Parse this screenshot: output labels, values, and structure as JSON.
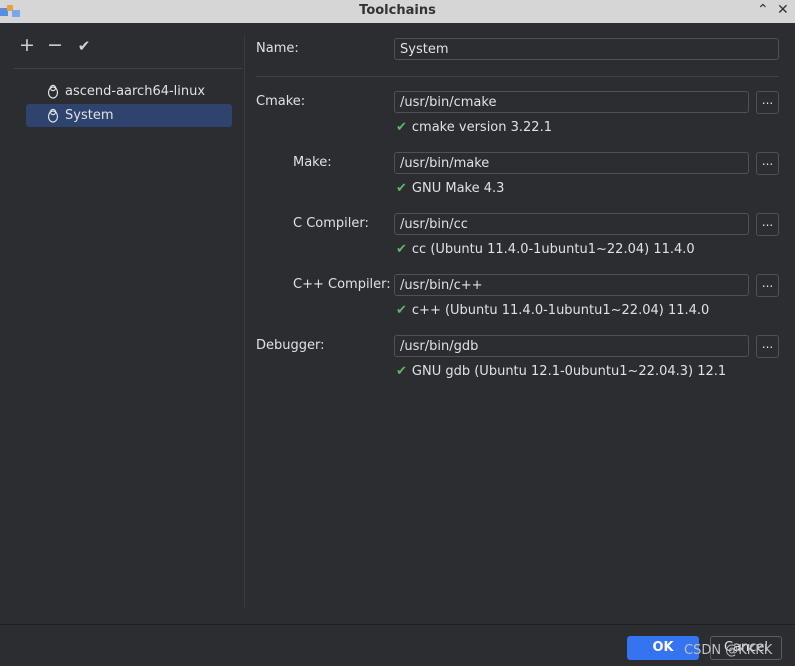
{
  "window": {
    "title": "Toolchains",
    "app_icon": "app-logo-icon",
    "minimize_glyph": "⌃",
    "close_glyph": "✕"
  },
  "sidebar": {
    "toolbar": [
      {
        "name": "add-button",
        "glyph": "+",
        "icon": "plus-icon"
      },
      {
        "name": "remove-button",
        "glyph": "−",
        "icon": "minus-icon"
      },
      {
        "name": "apply-button",
        "glyph": "✔",
        "icon": "check-icon"
      }
    ],
    "items": [
      {
        "label": "ascend-aarch64-linux",
        "icon": "linux-tux-icon",
        "selected": false
      },
      {
        "label": "System",
        "icon": "linux-tux-icon",
        "selected": true
      }
    ]
  },
  "form": {
    "name_label": "Name:",
    "name_value": "System",
    "cmake": {
      "label": "Cmake:",
      "value": "/usr/bin/cmake",
      "status": "cmake version 3.22.1"
    },
    "make": {
      "label": "Make:",
      "value": "/usr/bin/make",
      "status": "GNU Make 4.3"
    },
    "c_compiler": {
      "label": "C Compiler:",
      "value": "/usr/bin/cc",
      "status": "cc (Ubuntu 11.4.0-1ubuntu1~22.04) 11.4.0"
    },
    "cpp_compiler": {
      "label": "C++ Compiler:",
      "value": "/usr/bin/c++",
      "status": "c++ (Ubuntu 11.4.0-1ubuntu1~22.04) 11.4.0"
    },
    "debugger": {
      "label": "Debugger:",
      "value": "/usr/bin/gdb",
      "status": "GNU gdb (Ubuntu 12.1-0ubuntu1~22.04.3) 12.1"
    },
    "browse_label": "...",
    "check_glyph": "✔"
  },
  "footer": {
    "ok_label": "OK",
    "cancel_label": "Cancel",
    "watermark": "CSDN @KKKK"
  },
  "colors": {
    "accent": "#3574f0",
    "selection": "#2e436e",
    "success": "#5fb865",
    "background": "#2b2d30"
  }
}
